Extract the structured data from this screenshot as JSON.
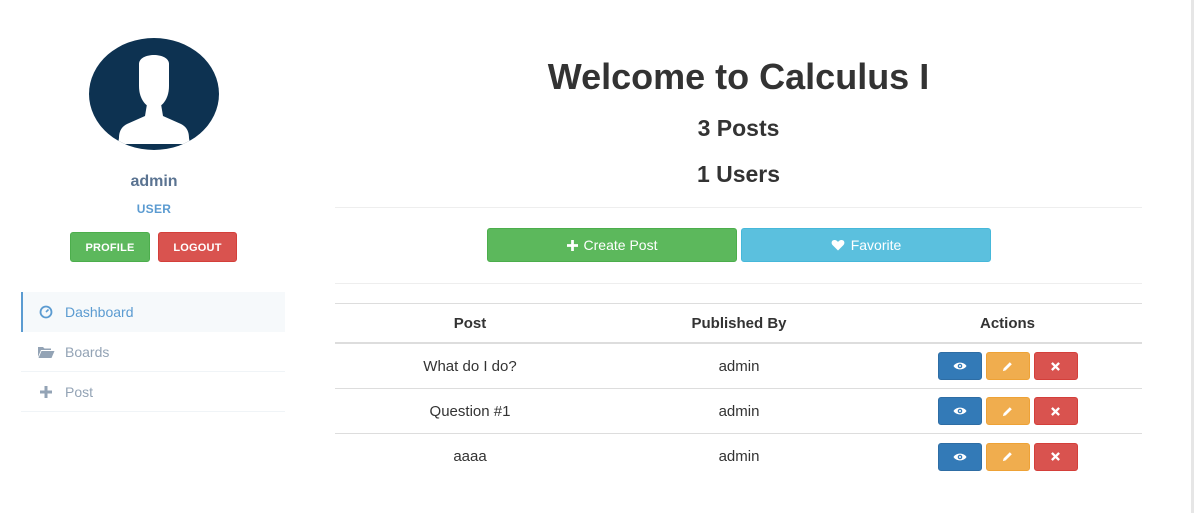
{
  "profile": {
    "name": "admin",
    "role": "USER",
    "profile_button": "PROFILE",
    "logout_button": "LOGOUT",
    "avatar_icon": "user-silhouette-icon"
  },
  "sidebar": {
    "items": [
      {
        "label": "Dashboard",
        "icon": "dashboard-icon",
        "active": true
      },
      {
        "label": "Boards",
        "icon": "folder-open-icon",
        "active": false
      },
      {
        "label": "Post",
        "icon": "plus-icon",
        "active": false
      }
    ]
  },
  "main": {
    "title": "Welcome to Calculus I",
    "posts_count": "3 Posts",
    "users_count": "1 Users",
    "create_post_button": "Create Post",
    "favorite_button": "Favorite"
  },
  "table": {
    "headers": [
      "Post",
      "Published By",
      "Actions"
    ],
    "rows": [
      {
        "post": "What do I do?",
        "published_by": "admin"
      },
      {
        "post": "Question #1",
        "published_by": "admin"
      },
      {
        "post": "aaaa",
        "published_by": "admin"
      }
    ]
  },
  "colors": {
    "success": "#5cb85c",
    "danger": "#d9534f",
    "info": "#5bc0de",
    "primary": "#337ab7",
    "warning": "#f0ad4e",
    "avatar_bg": "#0d3251",
    "sidebar_accent": "#5b9bd1"
  }
}
